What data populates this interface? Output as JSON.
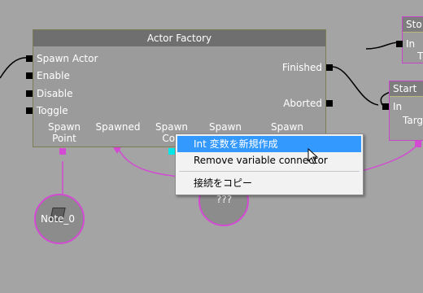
{
  "actor_factory": {
    "title": "Actor Factory",
    "inputs": [
      "Spawn Actor",
      "Enable",
      "Disable",
      "Toggle"
    ],
    "outputs": [
      "Finished",
      "Aborted"
    ],
    "vars": {
      "spawn_point": [
        "Spawn",
        "Point"
      ],
      "spawned": "Spawned",
      "spawn_count": [
        "Spawn",
        "Cou"
      ],
      "spawn_4": "Spawn",
      "spawn_5": "Spawn"
    }
  },
  "note_node": {
    "label": "Note_0"
  },
  "unknown_node": {
    "label": "???"
  },
  "right_nodes": {
    "top": {
      "title": "Sto",
      "pin_in": "In",
      "pin_target": "T"
    },
    "bottom": {
      "title": "Start",
      "pin_in": "In",
      "pin_target": "Targ"
    }
  },
  "context_menu": {
    "items": [
      "Int 変数を新規作成",
      "Remove variable connector",
      "接続をコピー"
    ]
  },
  "colors": {
    "canvas": "#a4a4a4",
    "wire_var": "#d24bd2",
    "menu_highlight": "#3399ff"
  }
}
